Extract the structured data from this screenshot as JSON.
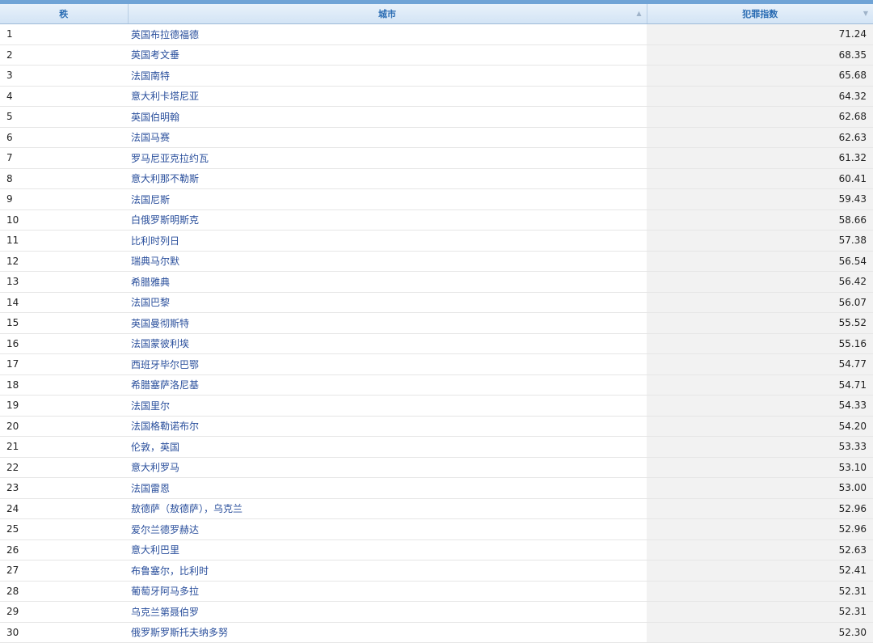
{
  "header": {
    "rank_label": "秩",
    "city_label": "城市",
    "crime_label": "犯罪指数"
  },
  "rows": [
    {
      "rank": "1",
      "city": "英国布拉德福德",
      "crime": "71.24"
    },
    {
      "rank": "2",
      "city": "英国考文垂",
      "crime": "68.35"
    },
    {
      "rank": "3",
      "city": "法国南特",
      "crime": "65.68"
    },
    {
      "rank": "4",
      "city": "意大利卡塔尼亚",
      "crime": "64.32"
    },
    {
      "rank": "5",
      "city": "英国伯明翰",
      "crime": "62.68"
    },
    {
      "rank": "6",
      "city": "法国马赛",
      "crime": "62.63"
    },
    {
      "rank": "7",
      "city": "罗马尼亚克拉约瓦",
      "crime": "61.32"
    },
    {
      "rank": "8",
      "city": "意大利那不勒斯",
      "crime": "60.41"
    },
    {
      "rank": "9",
      "city": "法国尼斯",
      "crime": "59.43"
    },
    {
      "rank": "10",
      "city": "白俄罗斯明斯克",
      "crime": "58.66"
    },
    {
      "rank": "11",
      "city": "比利时列日",
      "crime": "57.38"
    },
    {
      "rank": "12",
      "city": "瑞典马尔默",
      "crime": "56.54"
    },
    {
      "rank": "13",
      "city": "希腊雅典",
      "crime": "56.42"
    },
    {
      "rank": "14",
      "city": "法国巴黎",
      "crime": "56.07"
    },
    {
      "rank": "15",
      "city": "英国曼彻斯特",
      "crime": "55.52"
    },
    {
      "rank": "16",
      "city": "法国蒙彼利埃",
      "crime": "55.16"
    },
    {
      "rank": "17",
      "city": "西班牙毕尔巴鄂",
      "crime": "54.77"
    },
    {
      "rank": "18",
      "city": "希腊塞萨洛尼基",
      "crime": "54.71"
    },
    {
      "rank": "19",
      "city": "法国里尔",
      "crime": "54.33"
    },
    {
      "rank": "20",
      "city": "法国格勒诺布尔",
      "crime": "54.20"
    },
    {
      "rank": "21",
      "city": "伦敦，英国",
      "crime": "53.33"
    },
    {
      "rank": "22",
      "city": "意大利罗马",
      "crime": "53.10"
    },
    {
      "rank": "23",
      "city": "法国雷恩",
      "crime": "53.00"
    },
    {
      "rank": "24",
      "city": "敖德萨（敖德萨），乌克兰",
      "crime": "52.96"
    },
    {
      "rank": "25",
      "city": "爱尔兰德罗赫达",
      "crime": "52.96"
    },
    {
      "rank": "26",
      "city": "意大利巴里",
      "crime": "52.63"
    },
    {
      "rank": "27",
      "city": "布鲁塞尔，比利时",
      "crime": "52.41"
    },
    {
      "rank": "28",
      "city": "葡萄牙阿马多拉",
      "crime": "52.31"
    },
    {
      "rank": "29",
      "city": "乌克兰第聂伯罗",
      "crime": "52.31"
    },
    {
      "rank": "30",
      "city": "俄罗斯罗斯托夫纳多努",
      "crime": "52.30"
    }
  ]
}
